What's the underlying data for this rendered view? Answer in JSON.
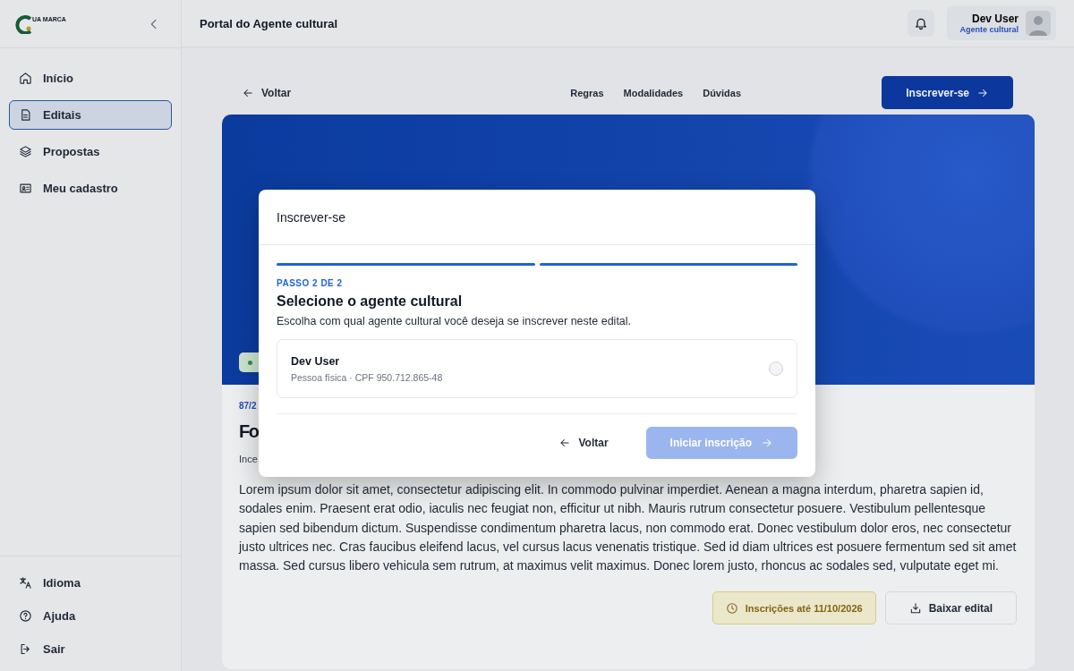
{
  "sidebar": {
    "logo_text": "UA MARCA",
    "items": [
      {
        "label": "Início",
        "selected": false
      },
      {
        "label": "Editais",
        "selected": true
      },
      {
        "label": "Propostas",
        "selected": false
      },
      {
        "label": "Meu cadastro",
        "selected": false
      }
    ],
    "footer_items": [
      {
        "label": "Idioma"
      },
      {
        "label": "Ajuda"
      },
      {
        "label": "Sair"
      }
    ]
  },
  "header": {
    "title": "Portal do Agente cultural",
    "user": {
      "name": "Dev User",
      "role": "Agente cultural"
    }
  },
  "edital": {
    "back": "Voltar",
    "tabs": [
      "Regras",
      "Modalidades",
      "Dúvidas"
    ],
    "cta": "Inscrever-se",
    "number": "87/2",
    "title": "Fo",
    "subtitle": "Ince",
    "description": "Lorem ipsum dolor sit amet, consectetur adipiscing elit. In commodo pulvinar imperdiet. Aenean a magna interdum, pharetra sapien id, sodales enim. Praesent erat odio, iaculis nec feugiat non, efficitur ut nibh. Mauris rutrum consectetur posuere. Vestibulum pellentesque sapien sed bibendum dictum. Suspendisse condimentum pharetra lacus, non commodo erat. Donec vestibulum dolor eros, nec consectetur justo ultrices nec. Cras faucibus eleifend lacus, vel cursus lacus venenatis tristique. Sed id diam ultrices est posuere fermentum sed sit amet massa. Sed cursus libero vehicula sem rutrum, at maximus velit maximus. Donec lorem justo, rhoncus ac sodales sed, vulputate eget mi.",
    "deadline": "Inscrições até 11/10/2026",
    "download": "Baixar edital"
  },
  "modal": {
    "title": "Inscrever-se",
    "steps": [
      {
        "done": true
      },
      {
        "done": true
      }
    ],
    "step_label": "PASSO 2 DE 2",
    "heading": "Selecione o agente cultural",
    "text": "Escolha com qual agente cultural você deseja se inscrever neste edital.",
    "options": [
      {
        "name": "Dev User",
        "detail": "Pessoa física · CPF 950.712.865-48",
        "selected": false
      }
    ],
    "back": "Voltar",
    "submit": {
      "label": "Iniciar inscrição",
      "disabled": true
    }
  }
}
